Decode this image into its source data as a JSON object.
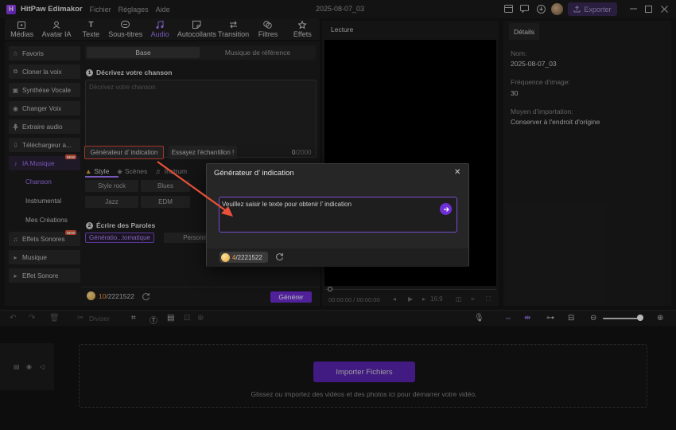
{
  "titlebar": {
    "app_name": "HitPaw Edimakor",
    "menu": [
      "Fichier",
      "Réglages",
      "Aide"
    ],
    "project_title": "2025-08-07_03",
    "export_label": "Exporter"
  },
  "toolbar": {
    "tabs": [
      {
        "label": "Médias",
        "icon": "media-icon"
      },
      {
        "label": "Avatar IA",
        "icon": "avatar-ai-icon"
      },
      {
        "label": "Texte",
        "icon": "text-icon"
      },
      {
        "label": "Sous-titres",
        "icon": "subtitles-icon"
      },
      {
        "label": "Audio",
        "icon": "audio-icon"
      },
      {
        "label": "Autocollants",
        "icon": "sticker-icon"
      },
      {
        "label": "Transition",
        "icon": "transition-icon"
      },
      {
        "label": "Filtres",
        "icon": "filter-icon"
      },
      {
        "label": "Effets",
        "icon": "effects-icon"
      }
    ],
    "active_tab": "Audio"
  },
  "sidebar": {
    "items": [
      {
        "label": "Favoris",
        "icon": "star-icon"
      },
      {
        "label": "Cloner la voix",
        "icon": "voice-clone-icon"
      },
      {
        "label": "Synthèse Vocale",
        "icon": "tts-icon"
      },
      {
        "label": "Changer Voix",
        "icon": "voice-change-icon"
      },
      {
        "label": "Extraire audio",
        "icon": "mic-icon"
      },
      {
        "label": "Téléchargeur a...",
        "icon": "download-icon"
      },
      {
        "label": "IA Musique",
        "icon": "ai-music-icon",
        "badge": "NEW"
      }
    ],
    "sub_items": [
      "Chanson",
      "Instrumental",
      "Mes Créations"
    ],
    "bottom_items": [
      {
        "label": "Effets Sonores",
        "icon": "sound-effects-icon",
        "badge": "NEW"
      },
      {
        "label": "Musique",
        "icon": "caret-right-icon"
      },
      {
        "label": "Effet Sonore",
        "icon": "caret-right-icon"
      }
    ]
  },
  "panel": {
    "segments": [
      "Base",
      "Musique de référence"
    ],
    "section1_num": "1",
    "section1_title": "Décrivez votre chanson",
    "textarea_placeholder": "Décrivez votre chanson",
    "hint_button": "Générateur d’ indication",
    "sample_button": "Essayez l'échantillon !",
    "counter_value": "0",
    "counter_max": "/2000",
    "subtabs": [
      "Style",
      "Scènes",
      "Instrum"
    ],
    "style_chips": [
      "Style rock",
      "Blues",
      "Jazz",
      "EDM"
    ],
    "section2_num": "2",
    "section2_title": "Écrire des Paroles",
    "lyrics_chip": "Génératio...tomatique",
    "person_chip": "Personn",
    "credits_used": "10",
    "credits_total": "/2221522",
    "generate_label": "Générer"
  },
  "preview": {
    "label": "Lecture",
    "time": "00:00:00 / 00:00:00",
    "ratio": "16:9"
  },
  "details": {
    "tab": "Détails",
    "fields": [
      {
        "label": "Nom:",
        "value": "2025-08-07_03"
      },
      {
        "label": "Fréquence d'image:",
        "value": "30"
      },
      {
        "label": "Moyen d'importation:",
        "value": "Conserver à l'endroit d'origine"
      }
    ]
  },
  "timeline_toolbar": {
    "split_label": "Diviser",
    "zoom_level": 0.86
  },
  "timeline": {
    "import_label": "Importer Fichiers",
    "drop_hint": "Glissez ou importez des vidéos et des photos ici pour démarrer votre vidéo."
  },
  "modal": {
    "title": "Générateur d’ indication",
    "placeholder": "Veuillez saisir le texte pour obtenir l’ indication",
    "credits_used": "4",
    "credits_total": "/2221522"
  },
  "colors": {
    "accent": "#a77bff",
    "button_purple": "#6f2fd6",
    "highlight_red": "#e04a35",
    "credit_orange": "#ff9a4a"
  }
}
